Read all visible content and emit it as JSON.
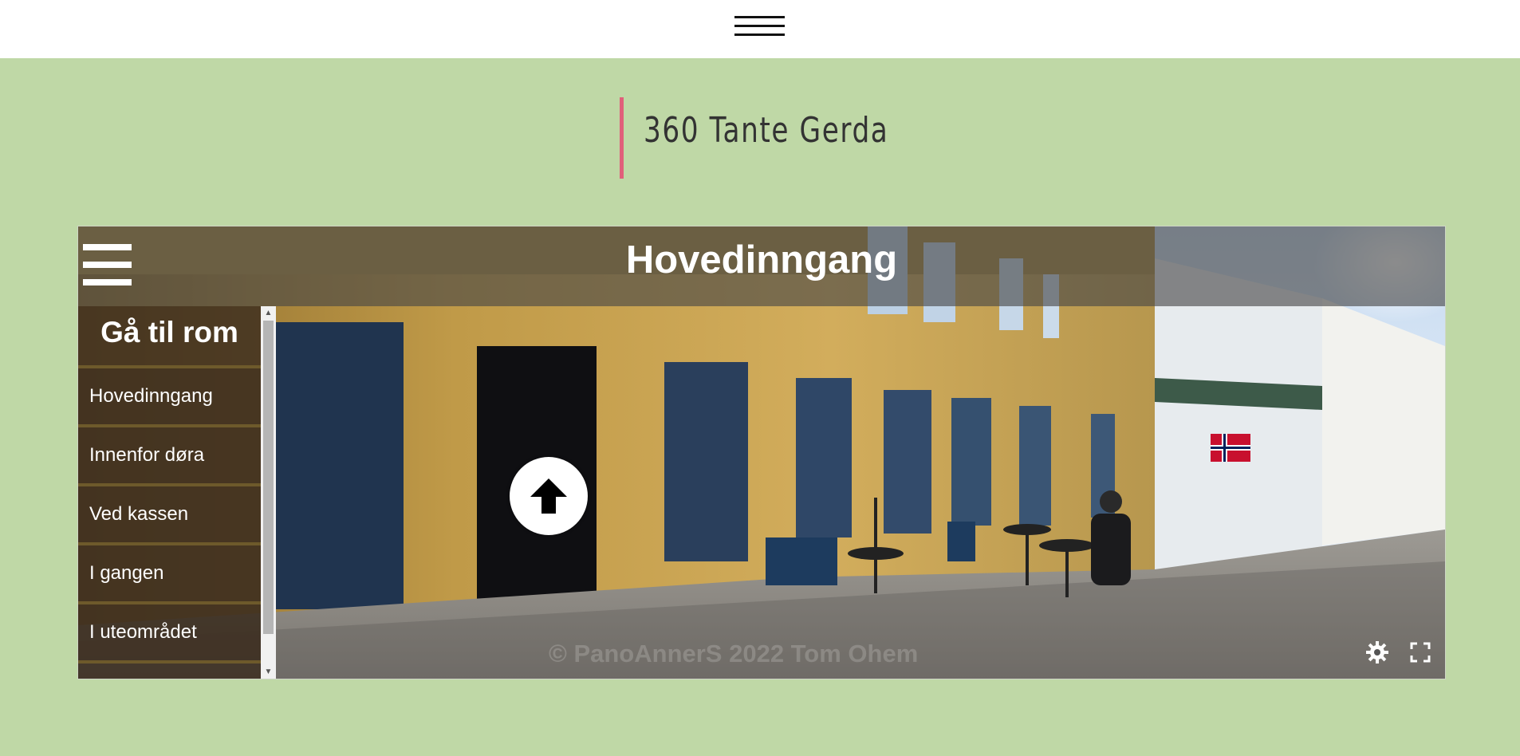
{
  "site": {
    "title": "360 Tante Gerda",
    "accent_color": "#e0607a",
    "background_color": "#bfd8a6"
  },
  "header": {
    "menu_icon": "hamburger-menu-icon"
  },
  "viewer": {
    "scene_title": "Hovedinngang",
    "menu_icon": "hamburger-menu-icon",
    "room_panel": {
      "heading": "Gå til rom",
      "rooms": [
        "Hovedinngang",
        "Innenfor døra",
        "Ved kassen",
        "I gangen",
        "I uteområdet"
      ]
    },
    "hotspot_icon": "arrow-up-icon",
    "watermark": "© PanoAnnerS 2022 Tom Ohem",
    "controls": {
      "settings_icon": "gear-icon",
      "fullscreen_icon": "fullscreen-icon"
    }
  }
}
